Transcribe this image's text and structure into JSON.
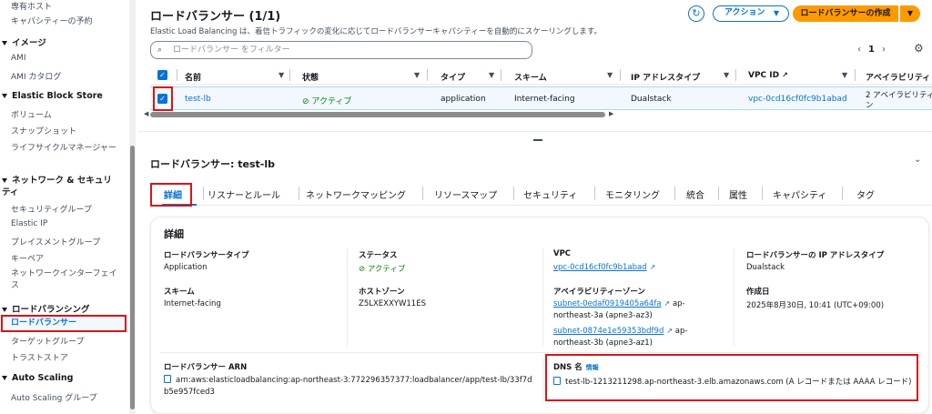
{
  "sidebar": {
    "items_top": [
      "専有ホスト",
      "キャパシティーの予約"
    ],
    "sec_image": "イメージ",
    "image_items": [
      "AMI",
      "AMI カタログ"
    ],
    "sec_ebs": "Elastic Block Store",
    "ebs_items": [
      "ボリューム",
      "スナップショット",
      "ライフサイクルマネージャー"
    ],
    "sec_net": "ネットワーク & セキュリティ",
    "net_items": [
      "セキュリティグループ",
      "Elastic IP",
      "プレイスメントグループ",
      "キーペア",
      "ネットワークインターフェイス"
    ],
    "sec_lb": "ロードバランシング",
    "lb_items": [
      "ロードバランサー",
      "ターゲットグループ",
      "トラストストア"
    ],
    "sec_as": "Auto Scaling",
    "as_items": [
      "Auto Scaling グループ"
    ]
  },
  "header": {
    "title": "ロードバランサー (1/1)",
    "description": "Elastic Load Balancing は、着信トラフィックの変化に応じてロードバランサーキャパシティーを自動的にスケーリングします。",
    "actions": "アクション",
    "create": "ロードバランサーの作成",
    "search_placeholder": "ロードバランサー をフィルター",
    "page": "1"
  },
  "table": {
    "columns": [
      "名前",
      "状態",
      "タイプ",
      "スキーム",
      "IP アドレスタイプ",
      "VPC ID",
      "アベイラビリティ"
    ],
    "row": {
      "name": "test-lb",
      "state": "アクティブ",
      "type": "application",
      "scheme": "Internet-facing",
      "ip": "Dualstack",
      "vpc": "vpc-0cd16cf0fc9b1abad",
      "az1": "2 アベイラビリティ",
      "az2": "ン"
    }
  },
  "detail": {
    "title": "ロードバランサー: test-lb",
    "tabs": [
      "詳細",
      "リスナーとルール",
      "ネットワークマッピング",
      "リソースマップ",
      "セキュリティ",
      "モニタリング",
      "統合",
      "属性",
      "キャパシティ",
      "タグ"
    ],
    "panel_title": "詳細",
    "lb_type_label": "ロードバランサータイプ",
    "lb_type": "Application",
    "status_label": "ステータス",
    "status": "アクティブ",
    "vpc_label": "VPC",
    "vpc": "vpc-0cd16cf0fc9b1abad",
    "ip_type_label": "ロードバランサーの IP アドレスタイプ",
    "ip_type": "Dualstack",
    "scheme_label": "スキーム",
    "scheme": "Internet-facing",
    "hosted_zone_label": "ホストゾーン",
    "hosted_zone": "Z5LXEXXYW11ES",
    "az_label": "アベイラビリティーゾーン",
    "subnet1": "subnet-0edaf0919405a64fa",
    "subnet1_suffix": "ap-",
    "subnet1_line2": "northeast-3a (apne3-az3)",
    "subnet2": "subnet-0874e1e59353bdf9d",
    "subnet2_suffix": "ap-",
    "subnet2_line2": "northeast-3b (apne3-az1)",
    "created_label": "作成日",
    "created": "2025年8月30日, 10:41 (UTC+09:00)",
    "arn_label": "ロードバランサー ARN",
    "arn_line1": "arn:aws:elasticloadbalancing:ap-northeast-3:772296357377:loadbalancer/app/test-lb/33f7d",
    "arn_line2": "b5e957fced3",
    "dns_label": "DNS 名",
    "dns_info": "情報",
    "dns": "test-lb-1213211298.ap-northeast-3.elb.amazonaws.com (A レコードまたは AAAA レコード)"
  }
}
